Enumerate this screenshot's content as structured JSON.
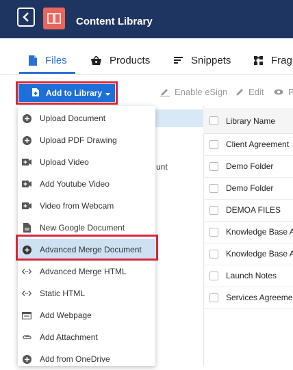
{
  "app": {
    "title": "Content Library"
  },
  "tabs": [
    {
      "label": "Files",
      "icon": "file-icon",
      "active": true
    },
    {
      "label": "Products",
      "icon": "basket-icon",
      "active": false
    },
    {
      "label": "Snippets",
      "icon": "lines-icon",
      "active": false
    },
    {
      "label": "Fragments",
      "icon": "puzzle-icon",
      "active": false,
      "visible_text": "Fragı"
    }
  ],
  "toolbar": {
    "add_label": "Add to Library",
    "enable_esign": "Enable eSign",
    "edit": "Edit",
    "preview_partial": "Pi"
  },
  "menu": {
    "items": [
      {
        "label": "Upload Document",
        "icon": "plus-circle-icon"
      },
      {
        "label": "Upload PDF Drawing",
        "icon": "plus-circle-icon"
      },
      {
        "label": "Upload Video",
        "icon": "video-plus-icon"
      },
      {
        "label": "Add Youtube Video",
        "icon": "video-plus-icon"
      },
      {
        "label": "Video from Webcam",
        "icon": "video-plus-icon"
      },
      {
        "label": "New Google Document",
        "icon": "document-icon"
      },
      {
        "label": "Advanced Merge Document",
        "icon": "plus-circle-icon",
        "selected": true
      },
      {
        "label": "Advanced Merge HTML",
        "icon": "code-icon"
      },
      {
        "label": "Static HTML",
        "icon": "code-icon"
      },
      {
        "label": "Add Webpage",
        "icon": "webpage-icon"
      },
      {
        "label": "Add Attachment",
        "icon": "paperclip-icon"
      },
      {
        "label": "Add from OneDrive",
        "icon": "plus-circle-icon"
      }
    ]
  },
  "left_panel": {
    "partial_text": "unt"
  },
  "table": {
    "header": "Library Name",
    "rows": [
      "Client Agreement",
      "Demo Folder",
      "Demo Folder",
      "DEMOA FILES",
      "Knowledge Base A",
      "Knowledge Base A",
      "Launch Notes",
      "Services Agreemer"
    ]
  },
  "colors": {
    "topbar": "#1f3561",
    "logo": "#e8665b",
    "accent": "#2b6fd6",
    "button": "#1f6fd8",
    "highlight_frame": "#d72638",
    "menu_selected": "#cde1f3"
  }
}
